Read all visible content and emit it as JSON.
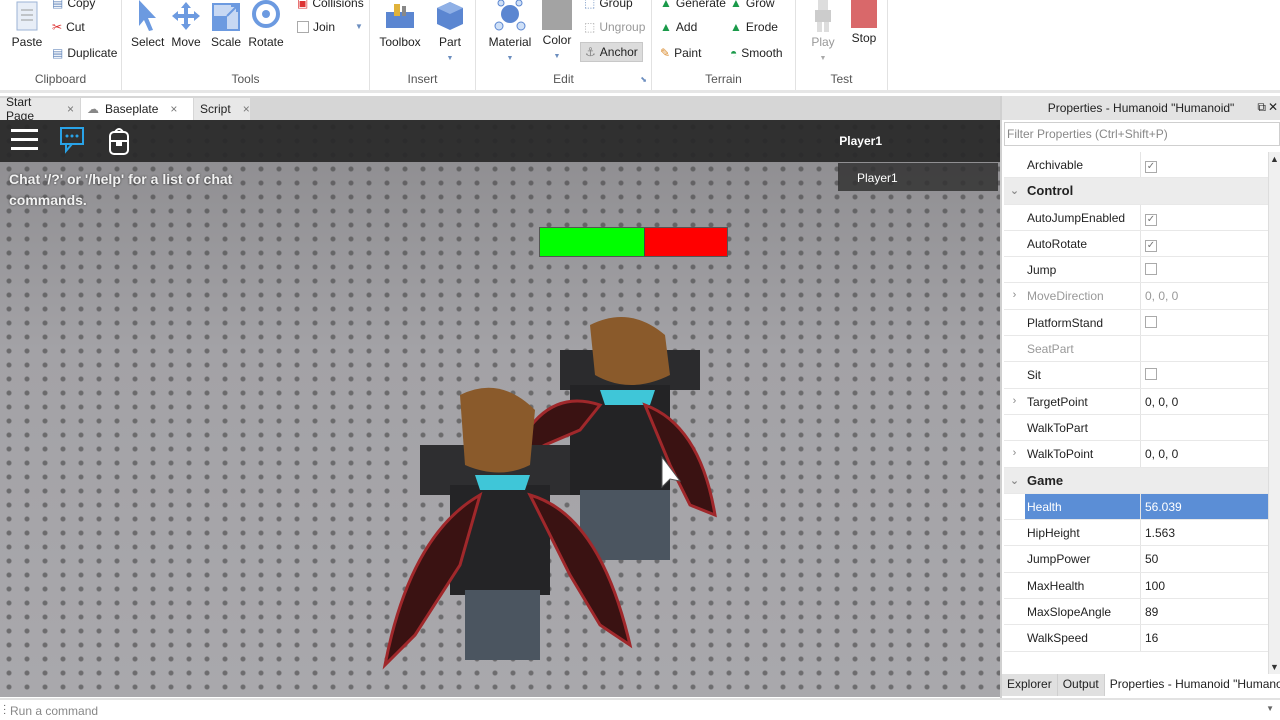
{
  "ribbon": {
    "groups": {
      "clipboard": "Clipboard",
      "tools": "Tools",
      "insert": "Insert",
      "edit": "Edit",
      "terrain": "Terrain",
      "test": "Test"
    },
    "clipboard": {
      "paste": "Paste",
      "copy": "Copy",
      "cut": "Cut",
      "duplicate": "Duplicate"
    },
    "tools": {
      "select": "Select",
      "move": "Move",
      "scale": "Scale",
      "rotate": "Rotate",
      "collisions": "Collisions",
      "join": "Join"
    },
    "insert": {
      "toolbox": "Toolbox",
      "part": "Part"
    },
    "edit": {
      "material": "Material",
      "color": "Color",
      "group": "Group",
      "ungroup": "Ungroup",
      "anchor": "Anchor"
    },
    "terrain": {
      "generate": "Generate",
      "grow": "Grow",
      "add": "Add",
      "erode": "Erode",
      "paint": "Paint",
      "smooth": "Smooth"
    },
    "test": {
      "play": "Play",
      "stop": "Stop"
    },
    "colors": {
      "accent_blue": "#5b8ed6",
      "stop_red": "#d9686a",
      "color_swatch": "#a3a3a3"
    }
  },
  "tabs": [
    {
      "label": "Start Page",
      "close": "×"
    },
    {
      "label": "Baseplate",
      "close": "×",
      "icon": "cloud-icon"
    },
    {
      "label": "Script",
      "close": "×"
    }
  ],
  "viewport": {
    "chat_message": "Chat '/?' or '/help' for a list of chat commands.",
    "player_name": "Player1",
    "player_list": [
      "Player1"
    ],
    "health": {
      "current": 56.039,
      "max": 100,
      "fill_color": "#00ff00",
      "empty_color": "#ff0000"
    }
  },
  "properties": {
    "title": "Properties - Humanoid \"Humanoid\"",
    "filter_placeholder": "Filter Properties (Ctrl+Shift+P)",
    "rows": [
      {
        "type": "prop",
        "name": "Archivable",
        "kind": "checkbox",
        "checked": true
      },
      {
        "type": "section",
        "name": "Control"
      },
      {
        "type": "prop",
        "name": "AutoJumpEnabled",
        "kind": "checkbox",
        "checked": true
      },
      {
        "type": "prop",
        "name": "AutoRotate",
        "kind": "checkbox",
        "checked": true
      },
      {
        "type": "prop",
        "name": "Jump",
        "kind": "checkbox",
        "checked": false
      },
      {
        "type": "prop",
        "name": "MoveDirection",
        "value": "0, 0, 0",
        "expandable": true,
        "disabled": true
      },
      {
        "type": "prop",
        "name": "PlatformStand",
        "kind": "checkbox",
        "checked": false
      },
      {
        "type": "prop",
        "name": "SeatPart",
        "value": "",
        "disabled": true
      },
      {
        "type": "prop",
        "name": "Sit",
        "kind": "checkbox",
        "checked": false
      },
      {
        "type": "prop",
        "name": "TargetPoint",
        "value": "0, 0, 0",
        "expandable": true
      },
      {
        "type": "prop",
        "name": "WalkToPart",
        "value": ""
      },
      {
        "type": "prop",
        "name": "WalkToPoint",
        "value": "0, 0, 0",
        "expandable": true
      },
      {
        "type": "section",
        "name": "Game"
      },
      {
        "type": "prop",
        "name": "Health",
        "value": "56.039",
        "selected": true
      },
      {
        "type": "prop",
        "name": "HipHeight",
        "value": "1.563"
      },
      {
        "type": "prop",
        "name": "JumpPower",
        "value": "50"
      },
      {
        "type": "prop",
        "name": "MaxHealth",
        "value": "100"
      },
      {
        "type": "prop",
        "name": "MaxSlopeAngle",
        "value": "89"
      },
      {
        "type": "prop",
        "name": "WalkSpeed",
        "value": "16"
      }
    ],
    "bottom_tabs": [
      "Explorer",
      "Output",
      "Properties - Humanoid \"Humanoid\""
    ]
  },
  "command_bar": {
    "placeholder": "Run a command"
  }
}
